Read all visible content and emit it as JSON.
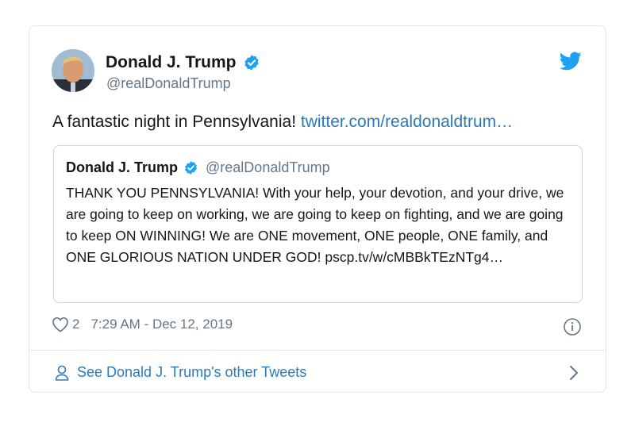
{
  "author": {
    "name": "Donald J. Trump",
    "handle": "@realDonaldTrump"
  },
  "tweet": {
    "text": "A fantastic night in Pennsylvania!",
    "link_text": "twitter.com/realdonaldtrum…"
  },
  "quote": {
    "name": "Donald J. Trump",
    "handle": "@realDonaldTrump",
    "text": "THANK YOU PENNSYLVANIA! With your help, your devotion, and your drive, we are going to keep on working, we are going to keep on fighting, and we are going to keep ON WINNING! We are ONE movement, ONE people, ONE family, and ONE GLORIOUS NATION UNDER GOD! pscp.tv/w/cMBBkTEzNTg4…"
  },
  "meta": {
    "likes": "2",
    "timestamp": "7:29 AM - Dec 12, 2019"
  },
  "footer": {
    "link_label": "See Donald J. Trump's other Tweets"
  },
  "colors": {
    "link": "#2b7bb9",
    "verified": "#1da1f2",
    "secondary_text": "#657786",
    "border": "#e1e8ed"
  },
  "icons": [
    "avatar",
    "verified-badge-icon",
    "twitter-bird-icon",
    "heart-icon",
    "info-icon",
    "person-icon",
    "chevron-right-icon"
  ]
}
